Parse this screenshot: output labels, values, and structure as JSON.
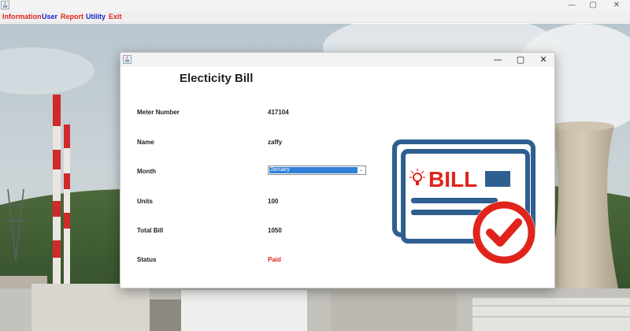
{
  "window": {
    "icon": "java-coffee-icon",
    "controls": {
      "minimize": "—",
      "maximize": "▢",
      "close": "✕"
    }
  },
  "menu": [
    {
      "label": "Information",
      "color": "#e0241c"
    },
    {
      "label": "User",
      "color": "#1a22c8"
    },
    {
      "label": "Report",
      "color": "#e0241c"
    },
    {
      "label": "Utility",
      "color": "#1a22c8"
    },
    {
      "label": "Exit",
      "color": "#e0241c"
    }
  ],
  "dialog": {
    "icon": "java-coffee-icon",
    "controls": {
      "minimize": "—",
      "maximize": "▢",
      "close": "✕"
    },
    "title": "Electicity Bill",
    "fields": {
      "meter_number": {
        "label": "Meter Number",
        "value": "417104"
      },
      "name": {
        "label": "Name",
        "value": "zaffy"
      },
      "month": {
        "label": "Month",
        "value": "January"
      },
      "units": {
        "label": "Units",
        "value": "100"
      },
      "total_bill": {
        "label": "Total Bill",
        "value": "1050"
      },
      "status": {
        "label": "Status",
        "value": "Paid",
        "color": "#e0241c"
      }
    },
    "graphic": {
      "text": "BILL",
      "icons": [
        "bill-document-icon",
        "lightbulb-icon",
        "checkmark-badge-icon"
      ],
      "colors": {
        "document": "#2f5f8f",
        "accent": "#e0241c"
      }
    }
  },
  "background": {
    "description_icon": "power-plant-background-image"
  }
}
